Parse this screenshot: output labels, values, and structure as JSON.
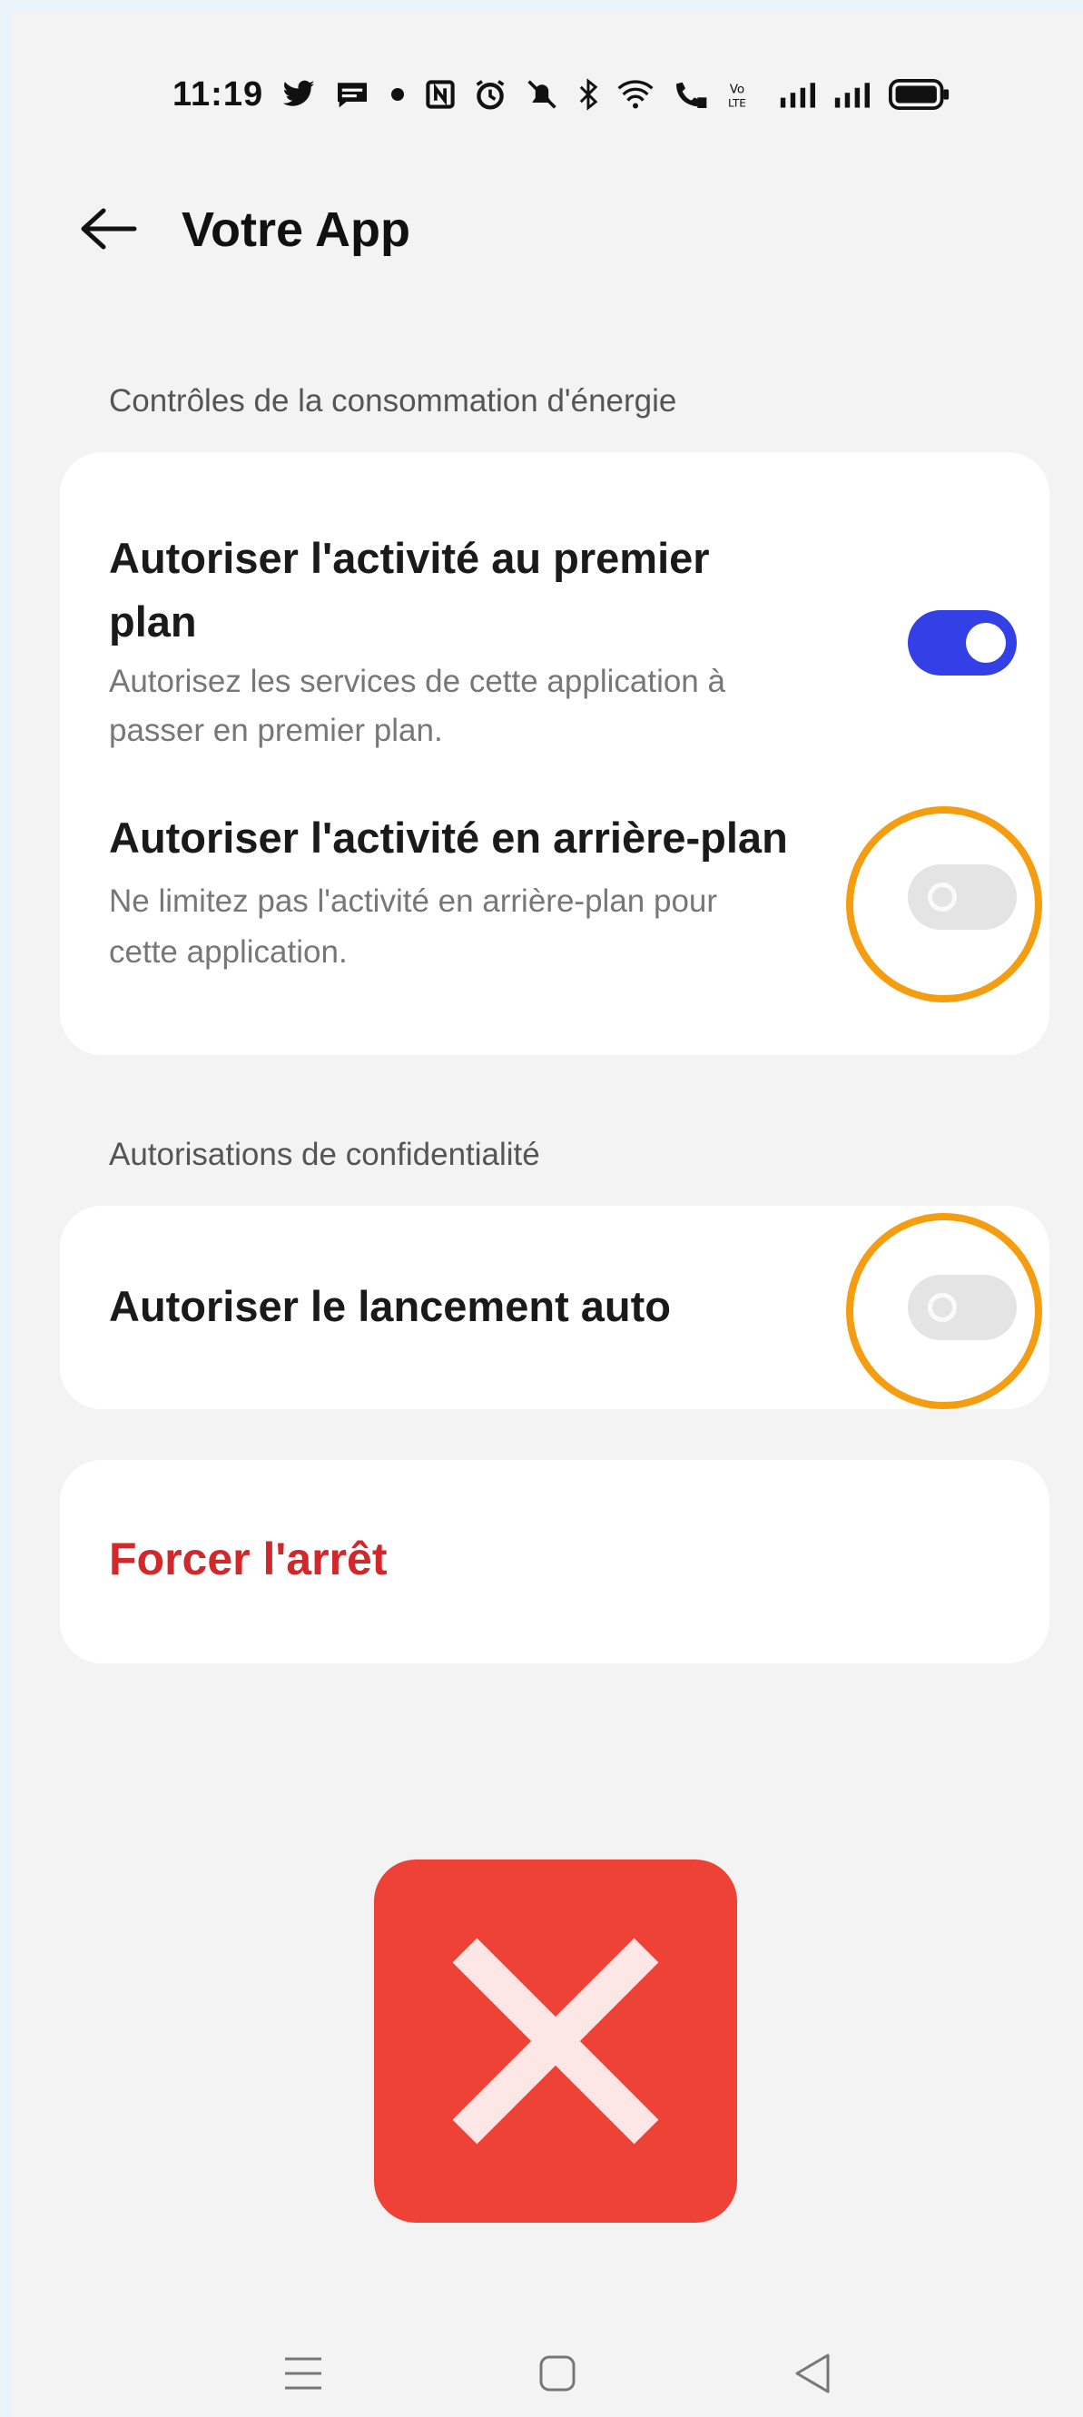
{
  "status_bar": {
    "time": "11:19",
    "icons": [
      "twitter-icon",
      "message-icon",
      "dot-icon",
      "nfc-icon",
      "alarm-icon",
      "mute-icon",
      "bluetooth-icon",
      "wifi-icon",
      "wifi-calling-icon",
      "volte-icon",
      "signal-icon",
      "signal-icon",
      "battery-icon"
    ]
  },
  "header": {
    "title": "Votre App"
  },
  "sections": {
    "energy": {
      "label": "Contrôles de la consommation d'énergie",
      "foreground": {
        "title_line1": "Autoriser l'activité au premier",
        "title_line2": "plan",
        "desc_line1": "Autorisez les services de cette application à",
        "desc_line2": "passer en premier plan.",
        "enabled": true
      },
      "background": {
        "title": "Autoriser l'activité en arrière-plan",
        "desc_line1": "Ne limitez pas l'activité en arrière-plan pour",
        "desc_line2": "cette application.",
        "enabled": false
      }
    },
    "privacy": {
      "label": "Autorisations de confidentialité",
      "auto_launch": {
        "title": "Autoriser le lancement auto",
        "enabled": false
      }
    }
  },
  "force_stop": {
    "label": "Forcer l'arrêt"
  },
  "colors": {
    "accent": "#3340e6",
    "danger": "#d2272b",
    "highlight": "#f59d10",
    "x_badge": "#ef4236"
  },
  "overlay": {
    "icon": "x-mark-icon",
    "highlight_marks": 2
  },
  "nav_bar": {
    "icons": [
      "menu-icon",
      "home-icon",
      "back-triangle-icon"
    ]
  }
}
